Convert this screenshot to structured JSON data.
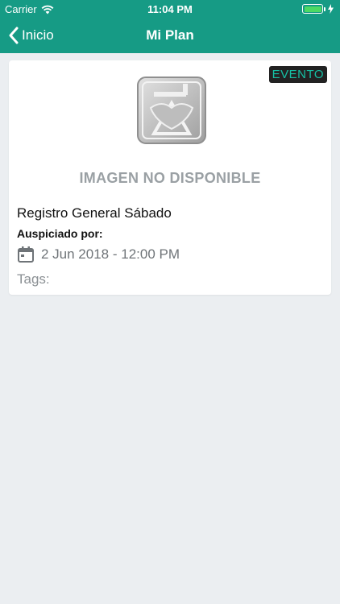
{
  "status_bar": {
    "carrier": "Carrier",
    "time": "11:04 PM"
  },
  "nav": {
    "back_label": "Inicio",
    "title": "Mi Plan"
  },
  "colors": {
    "nav_bg": "#169b85",
    "badge_text": "#15c0a4",
    "badge_bg": "#222222",
    "page_bg": "#ebeef1"
  },
  "event_card": {
    "badge": "EVENTO",
    "image_placeholder": "IMAGEN NO DISPONIBLE",
    "title": "Registro General Sábado",
    "sponsor_label": "Auspiciado por:",
    "date": "2 Jun 2018 - 12:00 PM",
    "tags_label": "Tags:"
  },
  "icons": [
    "wifi-icon",
    "battery-icon",
    "charging-icon",
    "chevron-left-icon",
    "calendar-icon",
    "placeholder-logo-icon"
  ]
}
